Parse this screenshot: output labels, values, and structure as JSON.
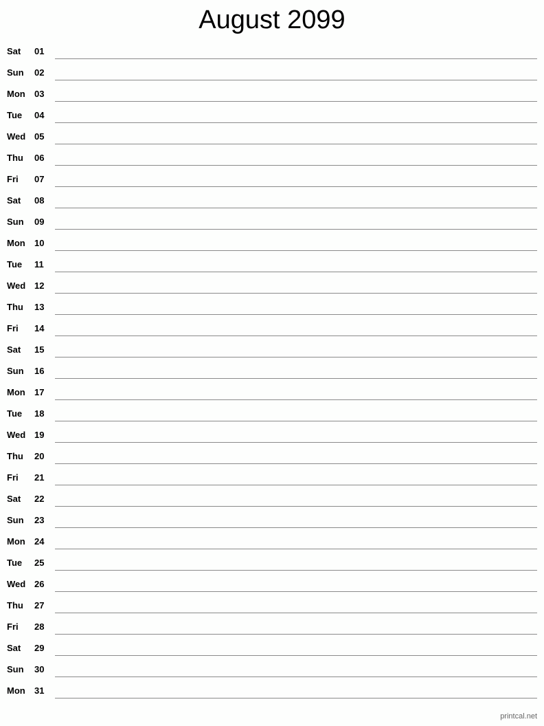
{
  "title": "August 2099",
  "days": [
    {
      "dow": "Sat",
      "num": "01"
    },
    {
      "dow": "Sun",
      "num": "02"
    },
    {
      "dow": "Mon",
      "num": "03"
    },
    {
      "dow": "Tue",
      "num": "04"
    },
    {
      "dow": "Wed",
      "num": "05"
    },
    {
      "dow": "Thu",
      "num": "06"
    },
    {
      "dow": "Fri",
      "num": "07"
    },
    {
      "dow": "Sat",
      "num": "08"
    },
    {
      "dow": "Sun",
      "num": "09"
    },
    {
      "dow": "Mon",
      "num": "10"
    },
    {
      "dow": "Tue",
      "num": "11"
    },
    {
      "dow": "Wed",
      "num": "12"
    },
    {
      "dow": "Thu",
      "num": "13"
    },
    {
      "dow": "Fri",
      "num": "14"
    },
    {
      "dow": "Sat",
      "num": "15"
    },
    {
      "dow": "Sun",
      "num": "16"
    },
    {
      "dow": "Mon",
      "num": "17"
    },
    {
      "dow": "Tue",
      "num": "18"
    },
    {
      "dow": "Wed",
      "num": "19"
    },
    {
      "dow": "Thu",
      "num": "20"
    },
    {
      "dow": "Fri",
      "num": "21"
    },
    {
      "dow": "Sat",
      "num": "22"
    },
    {
      "dow": "Sun",
      "num": "23"
    },
    {
      "dow": "Mon",
      "num": "24"
    },
    {
      "dow": "Tue",
      "num": "25"
    },
    {
      "dow": "Wed",
      "num": "26"
    },
    {
      "dow": "Thu",
      "num": "27"
    },
    {
      "dow": "Fri",
      "num": "28"
    },
    {
      "dow": "Sat",
      "num": "29"
    },
    {
      "dow": "Sun",
      "num": "30"
    },
    {
      "dow": "Mon",
      "num": "31"
    }
  ],
  "footer": "printcal.net"
}
